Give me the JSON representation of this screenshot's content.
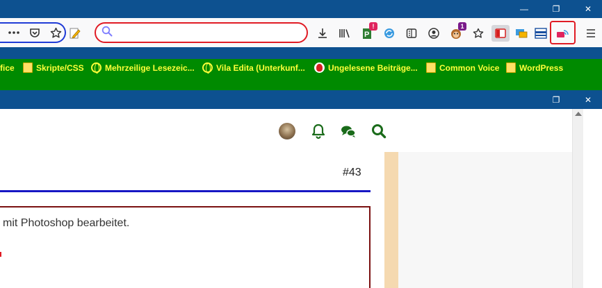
{
  "window": {
    "restore_glyph": "❐",
    "close_glyph": "✕",
    "minimize_glyph": "—"
  },
  "navbar": {
    "url_value": "",
    "url_placeholder": "",
    "badges": {
      "parkingpass": "!",
      "greasemonkey": "1"
    }
  },
  "bookmarks": [
    {
      "label": "fice",
      "icon": "none"
    },
    {
      "label": "Skripte/CSS",
      "icon": "folder-icon"
    },
    {
      "label": "Mehrzeilige Lesezeic...",
      "icon": "globe-icon"
    },
    {
      "label": "Vila Edita (Unterkunf...",
      "icon": "globe-icon"
    },
    {
      "label": "Ungelesene Beiträge...",
      "icon": "flame-icon"
    },
    {
      "label": "Common Voice",
      "icon": "folder-icon"
    },
    {
      "label": "WordPress",
      "icon": "folder-icon"
    }
  ],
  "post": {
    "number": "#43",
    "text": "mit Photoshop bearbeitet."
  },
  "colors": {
    "titlebar": "#0d5190",
    "bookmark_bar": "#008a00",
    "bookmark_text": "#ffff3a",
    "accent_green": "#1a6b1a",
    "post_border": "#7a1010",
    "blue_line": "#1717c4",
    "side_strip": "#f5d9b0"
  }
}
